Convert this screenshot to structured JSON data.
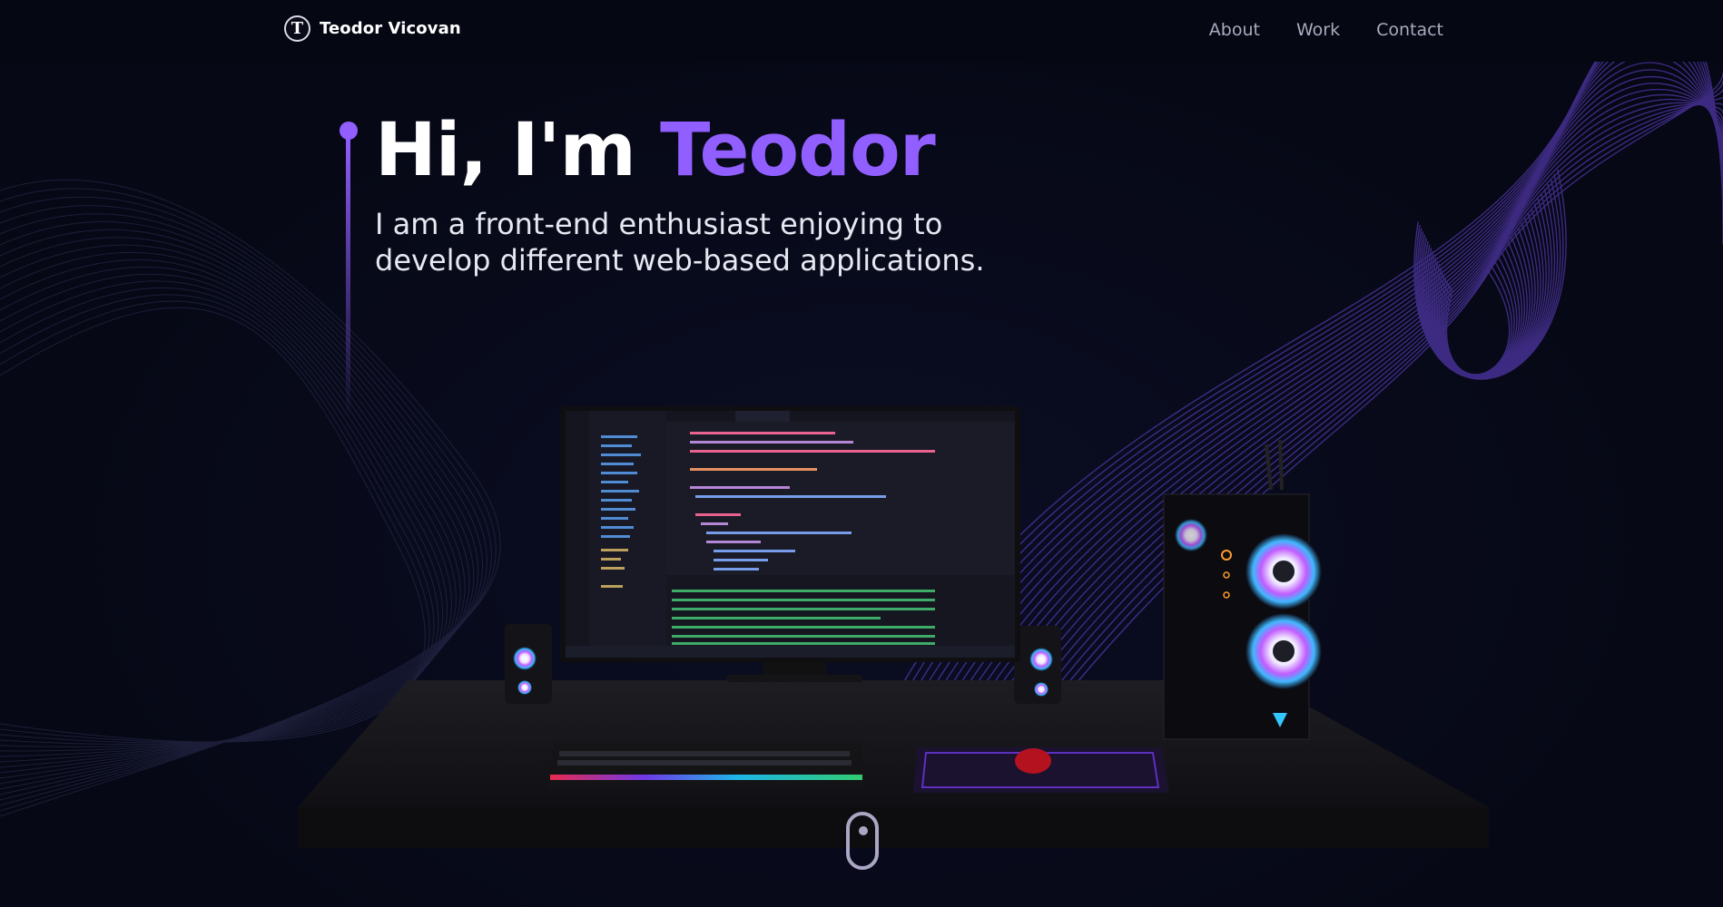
{
  "nav": {
    "brand": "Teodor Vicovan",
    "logo_letter": "T",
    "links": [
      {
        "label": "About"
      },
      {
        "label": "Work"
      },
      {
        "label": "Contact"
      }
    ]
  },
  "hero": {
    "greeting": "Hi, I'm ",
    "name": "Teodor",
    "subtitle": "I am a front-end enthusiast enjoying to develop different web-based applications."
  },
  "colors": {
    "accent": "#915eff",
    "background": "#060815",
    "text": "#ffffff",
    "nav_link": "#aaaabd"
  },
  "icons": {
    "logo": "t-monogram-icon",
    "scroll": "mouse-scroll-icon"
  }
}
